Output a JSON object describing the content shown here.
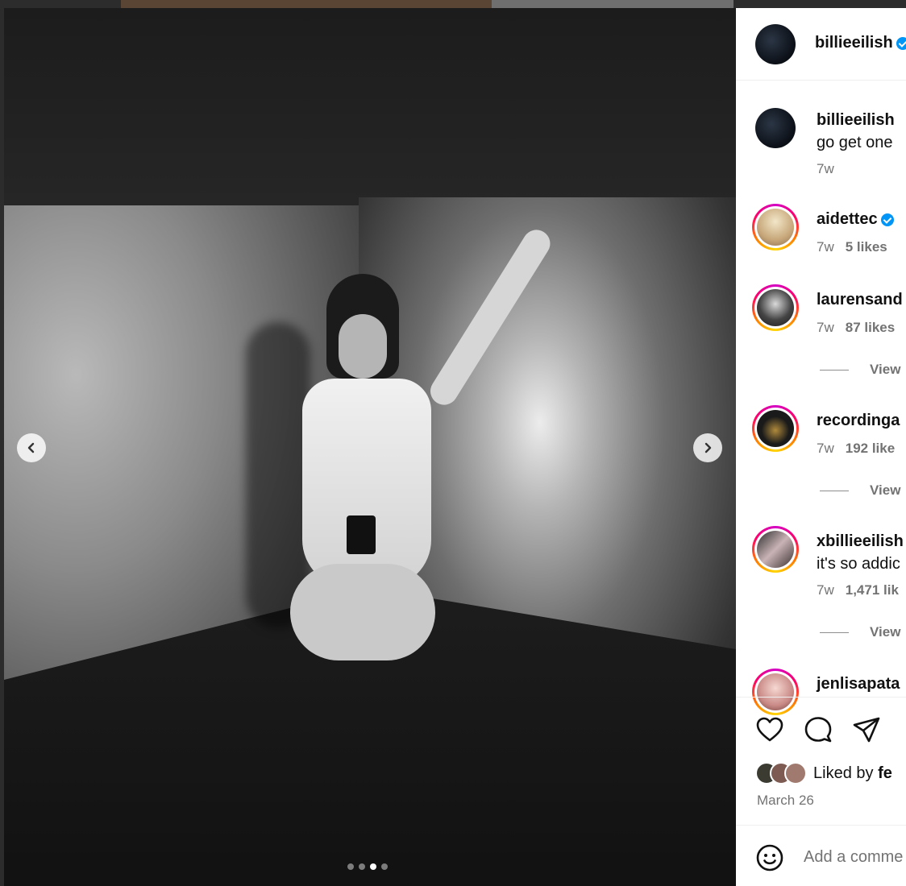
{
  "post": {
    "author": "billieeilish",
    "carousel": {
      "total": 4,
      "active_index": 2
    }
  },
  "comments": [
    {
      "username": "billieeilish",
      "text": "go get one",
      "time": "7w",
      "likes": "",
      "view_replies": "",
      "avatar": "dark"
    },
    {
      "username": "aidettec",
      "text": "",
      "time": "7w",
      "likes": "5 likes",
      "view_replies": "",
      "avatar": "blonde",
      "verified": true
    },
    {
      "username": "laurensand",
      "text": "",
      "time": "7w",
      "likes": "87 likes",
      "view_replies": "View",
      "avatar": "dark-hair"
    },
    {
      "username": "recordinga",
      "text": "",
      "time": "7w",
      "likes": "192 like",
      "view_replies": "View",
      "avatar": "grammy"
    },
    {
      "username": "xbillieeilish",
      "text": "it's so addic",
      "time": "7w",
      "likes": "1,471 lik",
      "view_replies": "View",
      "avatar": "collage"
    },
    {
      "username": "jenlisapata",
      "text": "",
      "time": "",
      "likes": "",
      "view_replies": "",
      "avatar": "pink"
    }
  ],
  "actions": {
    "like_icon": "heart-icon",
    "comment_icon": "comment-icon",
    "share_icon": "share-icon",
    "liked_by_prefix": "Liked by",
    "liked_by_name": "fe",
    "date": "March 26"
  },
  "add_comment": {
    "placeholder": "Add a comme",
    "emoji_icon": "emoji-icon"
  },
  "colors": {
    "verified": "#0095f6",
    "meta": "#737373",
    "ring_start": "#d300c5",
    "ring_end": "#ffd600"
  }
}
